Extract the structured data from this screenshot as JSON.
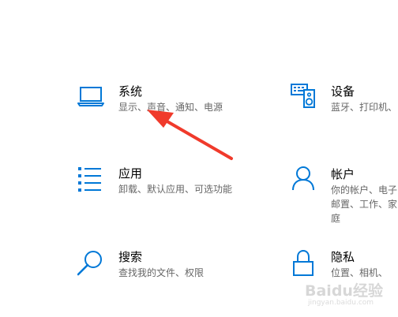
{
  "colors": {
    "accent": "#0078d7",
    "title_text": "#000000",
    "desc_text": "#666666",
    "annotation_arrow": "#f03a2b"
  },
  "tiles": [
    {
      "name": "system",
      "icon": "laptop-icon",
      "title": "系统",
      "desc": "显示、声音、通知、电源"
    },
    {
      "name": "devices",
      "icon": "keyboard-speaker-icon",
      "title": "设备",
      "desc": "蓝牙、打印机、"
    },
    {
      "name": "apps",
      "icon": "list-icon",
      "title": "应用",
      "desc": "卸载、默认应用、可选功能"
    },
    {
      "name": "accounts",
      "icon": "person-icon",
      "title": "帐户",
      "desc": "你的帐户、电子邮置、工作、家庭"
    },
    {
      "name": "search",
      "icon": "search-icon",
      "title": "搜索",
      "desc": "查找我的文件、权限"
    },
    {
      "name": "privacy",
      "icon": "lock-icon",
      "title": "隐私",
      "desc": "位置、相机、"
    }
  ],
  "watermark": {
    "main": "Baidu经验",
    "sub": "jingyan.baidu.com"
  }
}
